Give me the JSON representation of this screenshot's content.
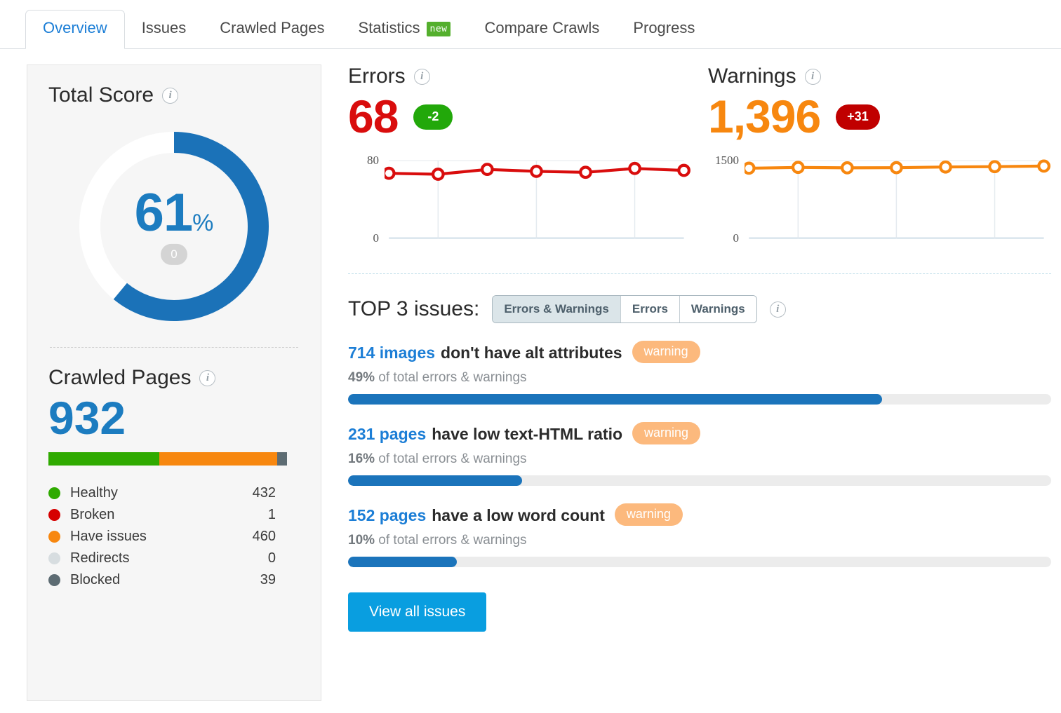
{
  "tabs": [
    {
      "label": "Overview",
      "active": true,
      "badge": null
    },
    {
      "label": "Issues",
      "active": false,
      "badge": null
    },
    {
      "label": "Crawled Pages",
      "active": false,
      "badge": null
    },
    {
      "label": "Statistics",
      "active": false,
      "badge": "new"
    },
    {
      "label": "Compare Crawls",
      "active": false,
      "badge": null
    },
    {
      "label": "Progress",
      "active": false,
      "badge": null
    }
  ],
  "total_score": {
    "title": "Total Score",
    "info_icon": "info-icon",
    "percent": "61",
    "percent_symbol": "%",
    "delta": "0",
    "value": 61,
    "arc_color": "#1b72b8",
    "track_color": "#ffffff"
  },
  "crawled_pages": {
    "title": "Crawled Pages",
    "info_icon": "info-icon",
    "total": "932",
    "legend": [
      {
        "label": "Healthy",
        "value": "432",
        "color": "#2faa00"
      },
      {
        "label": "Broken",
        "value": "1",
        "color": "#d60000"
      },
      {
        "label": "Have issues",
        "value": "460",
        "color": "#f7870f"
      },
      {
        "label": "Redirects",
        "value": "0",
        "color": "#d7dde0"
      },
      {
        "label": "Blocked",
        "value": "39",
        "color": "#5d6c73"
      }
    ],
    "bar_segments": [
      {
        "name": "Healthy",
        "percent": 46.4,
        "color": "#2faa00"
      },
      {
        "name": "Have issues",
        "percent": 49.4,
        "color": "#f7870f"
      },
      {
        "name": "Blocked",
        "percent": 4.2,
        "color": "#5d6c73"
      }
    ]
  },
  "errors": {
    "title": "Errors",
    "info_icon": "info-icon",
    "number": "68",
    "delta": "-2",
    "delta_kind": "green",
    "axis_top": "80",
    "axis_bottom": "0"
  },
  "warnings": {
    "title": "Warnings",
    "info_icon": "info-icon",
    "number": "1,396",
    "delta": "+31",
    "delta_kind": "red",
    "axis_top": "1500",
    "axis_bottom": "0"
  },
  "top3": {
    "label": "TOP 3 issues:",
    "info_icon": "info-icon",
    "filters": [
      {
        "label": "Errors & Warnings",
        "selected": true
      },
      {
        "label": "Errors",
        "selected": false
      },
      {
        "label": "Warnings",
        "selected": false
      }
    ],
    "issues": [
      {
        "qty": "714 images",
        "text": "don't have alt attributes",
        "tag": "warning",
        "percent_label": "49%",
        "sub": "of total errors & warnings",
        "percent": 49
      },
      {
        "qty": "231 pages",
        "text": "have low text-HTML ratio",
        "tag": "warning",
        "percent_label": "16%",
        "sub": "of total errors & warnings",
        "percent": 16
      },
      {
        "qty": "152 pages",
        "text": "have a low word count",
        "tag": "warning",
        "percent_label": "10%",
        "sub": "of total errors & warnings",
        "percent": 10
      }
    ],
    "view_all_label": "View all issues"
  },
  "chart_data": [
    {
      "type": "line",
      "title": "Errors",
      "x": [
        1,
        2,
        3,
        4,
        5,
        6,
        7
      ],
      "values": [
        67,
        66,
        71,
        69,
        68,
        72,
        70
      ],
      "ylim": [
        0,
        80
      ],
      "ytick_labels": [
        "0",
        "80"
      ],
      "color": "#d90d0d",
      "marker": "open-circle",
      "grid": "vertical-at-x2-x4-x6",
      "xlabel": "",
      "ylabel": ""
    },
    {
      "type": "line",
      "title": "Warnings",
      "x": [
        1,
        2,
        3,
        4,
        5,
        6,
        7
      ],
      "values": [
        1355,
        1370,
        1362,
        1365,
        1378,
        1385,
        1396
      ],
      "ylim": [
        0,
        1500
      ],
      "ytick_labels": [
        "0",
        "1500"
      ],
      "color": "#f7870f",
      "marker": "open-circle",
      "grid": "vertical-at-x2-x4-x6",
      "xlabel": "",
      "ylabel": ""
    }
  ]
}
